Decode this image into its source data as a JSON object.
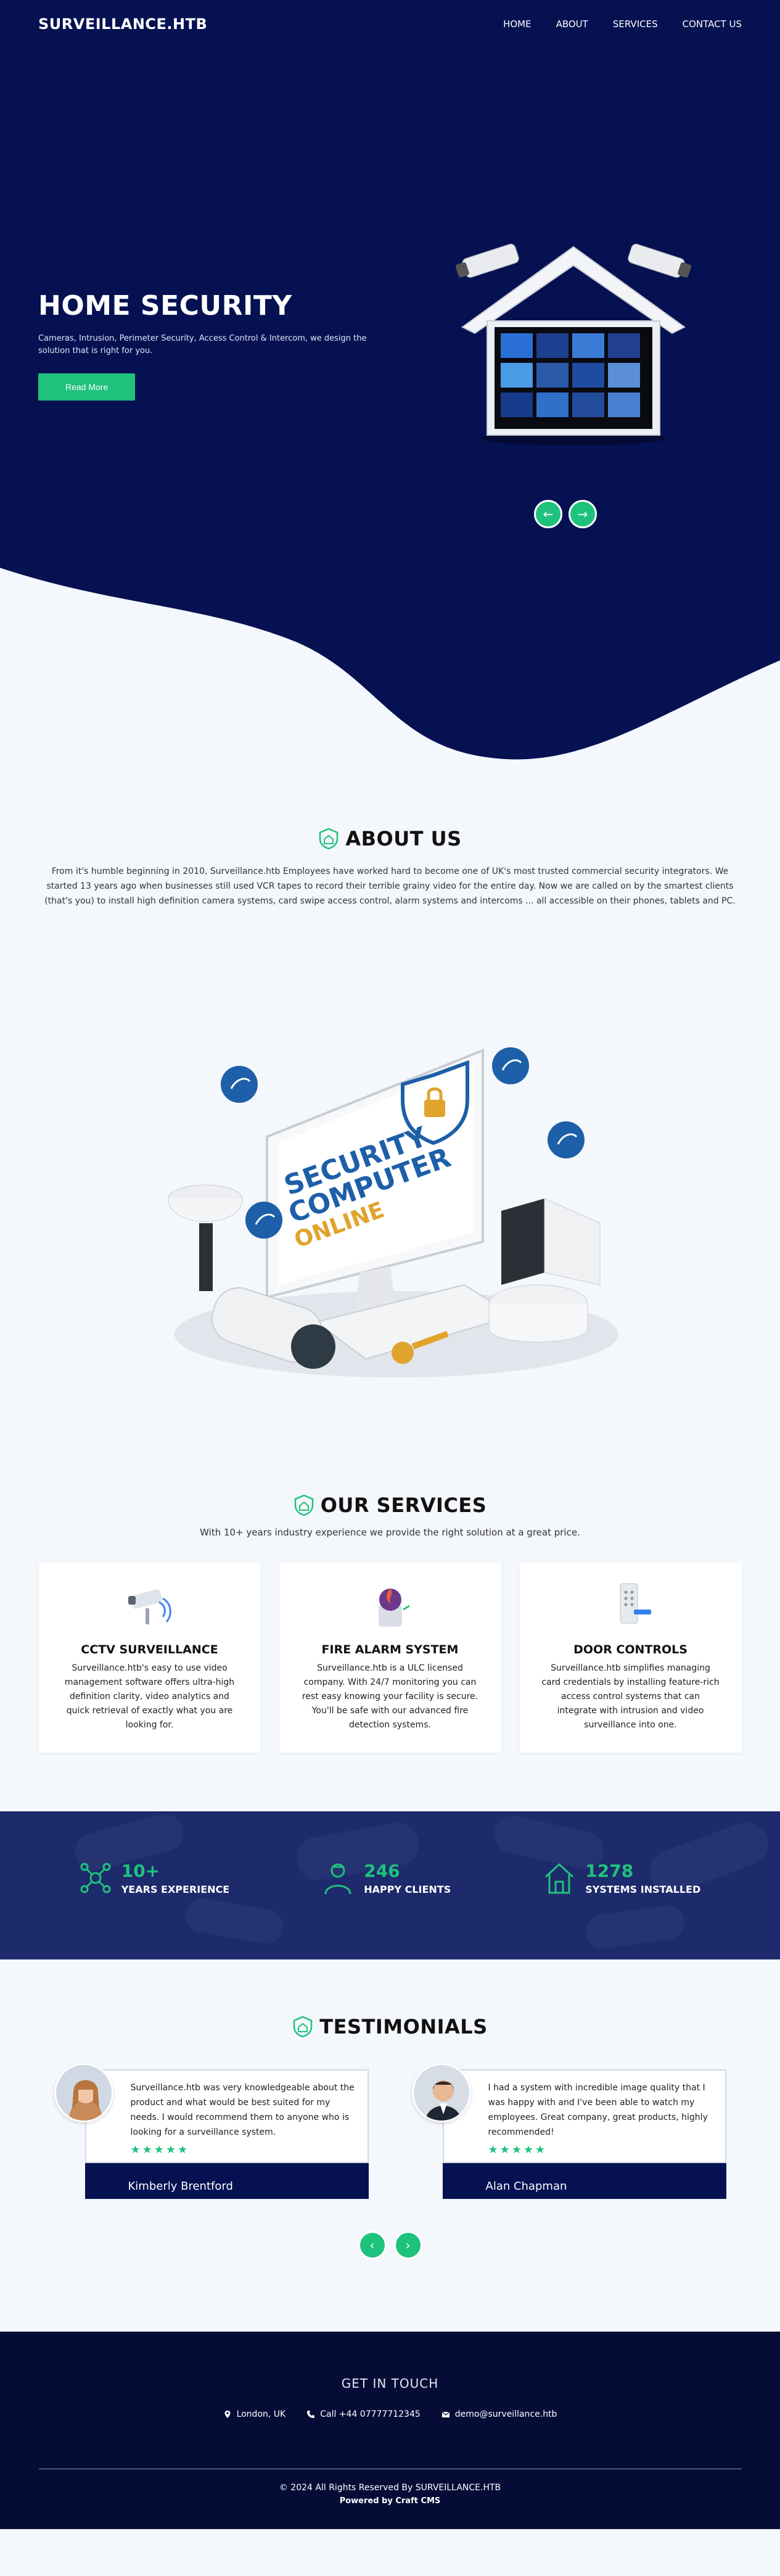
{
  "nav": {
    "brand": "SURVEILLANCE.HTB",
    "links": [
      "HOME",
      "ABOUT",
      "SERVICES",
      "CONTACT US"
    ]
  },
  "hero": {
    "title": "HOME SECURITY",
    "subtitle": "Cameras, Intrusion, Perimeter Security, Access Control & Intercom, we design the solution that is right for you.",
    "button": "Read More",
    "prev_icon": "arrow-left-icon",
    "next_icon": "arrow-right-icon"
  },
  "about": {
    "title": "ABOUT US",
    "text": "From it's humble beginning in 2010, Surveillance.htb Employees have worked hard to become one of UK's most trusted commercial security integrators. We started 13 years ago when businesses still used VCR tapes to record their terrible grainy video for the entire day. Now we are called on by the smartest clients (that's you) to install high definition camera systems, card swipe access control, alarm systems and intercoms ... all accessible on their phones, tablets and PC.",
    "illustration_text": [
      "SECURITY",
      "COMPUTER",
      "ONLINE"
    ]
  },
  "services": {
    "title": "OUR SERVICES",
    "subtitle": "With 10+ years industry experience we provide the right solution at a great price.",
    "items": [
      {
        "title": "CCTV SURVEILLANCE",
        "desc": "Surveillance.htb's easy to use video management software offers ultra-high definition clarity, video analytics and quick retrieval of exactly what you are looking for.",
        "icon": "cctv-camera-icon"
      },
      {
        "title": "FIRE ALARM SYSTEM",
        "desc": "Surveillance.htb is a ULC licensed company. With 24/7 monitoring you can rest easy knowing your facility is secure. You'll be safe with our advanced fire detection systems.",
        "icon": "fire-alarm-icon"
      },
      {
        "title": "DOOR CONTROLS",
        "desc": "Surveillance.htb simplifies managing card credentials by installing feature-rich access control systems that can integrate with intrusion and video surveillance into one.",
        "icon": "door-keypad-icon"
      }
    ]
  },
  "stats": [
    {
      "num": "10+",
      "label": "YEARS EXPERIENCE",
      "icon": "network-icon"
    },
    {
      "num": "246",
      "label": "HAPPY CLIENTS",
      "icon": "person-icon"
    },
    {
      "num": "1278",
      "label": "SYSTEMS INSTALLED",
      "icon": "house-shield-icon"
    }
  ],
  "testimonials": {
    "title": "TESTIMONIALS",
    "items": [
      {
        "quote": "Surveillance.htb was very knowledgeable about the product and what would be best suited for my needs. I would recommend them to anyone who is looking for a surveillance system.",
        "name": "Kimberly Brentford",
        "stars": "★★★★★"
      },
      {
        "quote": "I had a system with incredible image quality that I was happy with and I've been able to watch my employees. Great company, great products, highly recommended!",
        "name": "Alan Chapman",
        "stars": "★★★★★"
      }
    ]
  },
  "footer": {
    "title": "GET IN TOUCH",
    "location": "London, UK",
    "phone": "Call +44 07777712345",
    "email": "demo@surveillance.htb",
    "copyright": "© 2024 All Rights Reserved By SURVEILLANCE.HTB",
    "powered": "Powered by Craft CMS"
  },
  "colors": {
    "navy": "#061152",
    "green": "#1ec27c",
    "stats_bg": "#1d2a6b",
    "footer_bg": "#050d36"
  }
}
